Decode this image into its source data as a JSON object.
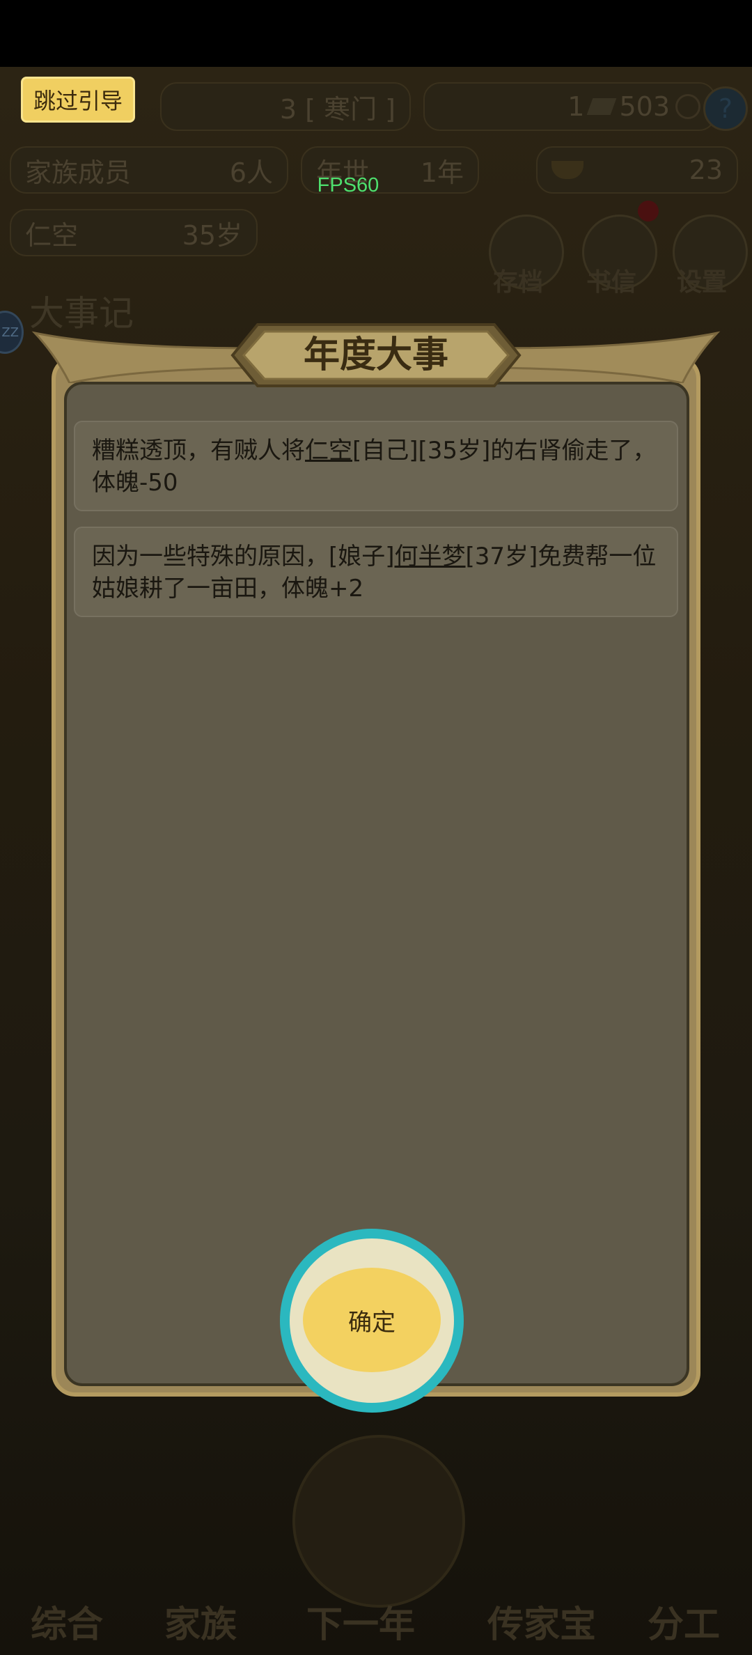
{
  "skip_guide": "跳过引导",
  "fps": "FPS60",
  "top": {
    "clan_rank": "3 [ 寒门 ]",
    "currency1": "1",
    "currency2": "503",
    "help": "?",
    "family_label": "家族成员",
    "family_count": "6人",
    "year_label": "年世",
    "year_value": "1年",
    "gold": "23",
    "player_name": "仁空",
    "player_age": "35岁",
    "btn_save": "存档",
    "btn_mail": "书信",
    "btn_settings": "设置",
    "chronicle_title": "大事记",
    "zz": "ZZ"
  },
  "modal": {
    "title": "年度大事",
    "events": [
      {
        "before": "糟糕透顶，有贼人将",
        "name": "仁空",
        "after": "[自己][35岁]的右肾偷走了，体魄-50"
      },
      {
        "before": "因为一些特殊的原因，[娘子]",
        "name": "何半梦",
        "after": "[37岁]免费帮一位姑娘耕了一亩田，体魄+2"
      }
    ],
    "confirm": "确定"
  },
  "nav": {
    "tabs": [
      "综合",
      "家族",
      "下一年",
      "传家宝",
      "分工"
    ]
  }
}
